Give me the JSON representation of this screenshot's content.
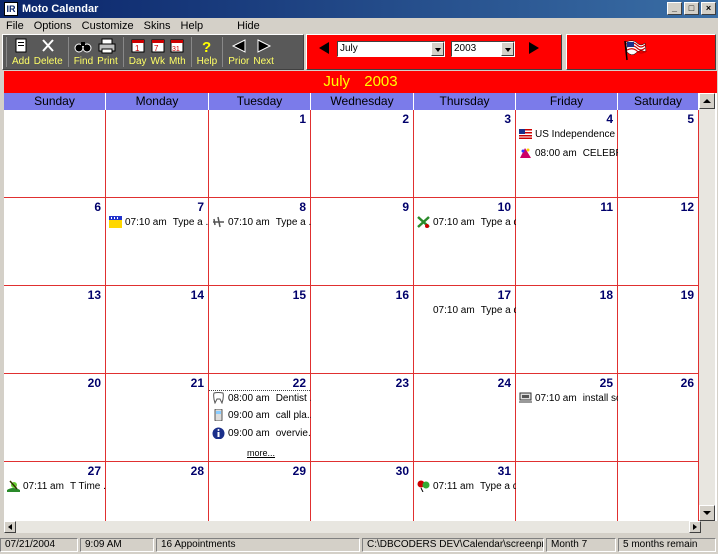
{
  "window": {
    "title": "Moto Calendar",
    "icon_text": "IR"
  },
  "menu": [
    "File",
    "Options",
    "Customize",
    "Skins",
    "Help",
    "Hide"
  ],
  "toolbar": {
    "add": "Add",
    "delete": "Delete",
    "find": "Find",
    "print": "Print",
    "day": "Day",
    "wk": "Wk",
    "mth": "Mth",
    "help": "Help",
    "prior": "Prior",
    "next": "Next"
  },
  "nav": {
    "month_value": "July",
    "year_value": "2003"
  },
  "header": {
    "month": "July",
    "year": "2003"
  },
  "weekdays": [
    "Sunday",
    "Monday",
    "Tuesday",
    "Wednesday",
    "Thursday",
    "Friday",
    "Saturday"
  ],
  "weeks": [
    [
      "",
      "",
      "1",
      "2",
      "3",
      "4",
      "5"
    ],
    [
      "6",
      "7",
      "8",
      "9",
      "10",
      "11",
      "12"
    ],
    [
      "13",
      "14",
      "15",
      "16",
      "17",
      "18",
      "19"
    ],
    [
      "20",
      "21",
      "22",
      "23",
      "24",
      "25",
      "26"
    ],
    [
      "27",
      "28",
      "29",
      "30",
      "31",
      "",
      ""
    ]
  ],
  "appointments": {
    "d4a": {
      "icon": "us-flag-icon",
      "time": "",
      "text": "US Independence ..."
    },
    "d4b": {
      "icon": "celebration-icon",
      "time": "08:00 am",
      "text": "CELEBR..."
    },
    "d7": {
      "icon": "calendar-icon",
      "time": "07:10 am",
      "text": "Type a ..."
    },
    "d8": {
      "icon": "airplane-icon",
      "time": "07:10 am",
      "text": "Type a ..."
    },
    "d10": {
      "icon": "tools-icon",
      "time": "07:10 am",
      "text": "Type a d..."
    },
    "d17": {
      "icon": "",
      "time": "07:10 am",
      "text": "Type a d..."
    },
    "d22a": {
      "icon": "tooth-icon",
      "time": "08:00 am",
      "text": "Dentist ..."
    },
    "d22b": {
      "icon": "phone-icon",
      "time": "09:00 am",
      "text": "call pla..."
    },
    "d22c": {
      "icon": "info-icon",
      "time": "09:00 am",
      "text": "overvie..."
    },
    "d22more": "more...",
    "d25": {
      "icon": "computer-icon",
      "time": "07:10 am",
      "text": "install sof..."
    },
    "d27": {
      "icon": "golf-icon",
      "time": "07:11 am",
      "text": "T Time ..."
    },
    "d31": {
      "icon": "balloons-icon",
      "time": "07:11 am",
      "text": "Type a d..."
    }
  },
  "status": {
    "date": "07/21/2004",
    "time": "9:09 AM",
    "appointments": "16  Appointments",
    "path": "C:\\DBCODERS DEV\\Calendar\\screenprint.cal",
    "month": "Month  7",
    "remain": "5 months remain"
  },
  "colors": {
    "accent_red": "#ff0000",
    "header_yellow": "#ffff00",
    "weekday_blue": "#7b7bea",
    "grid_line": "#e03030",
    "daynum": "#00006b"
  }
}
